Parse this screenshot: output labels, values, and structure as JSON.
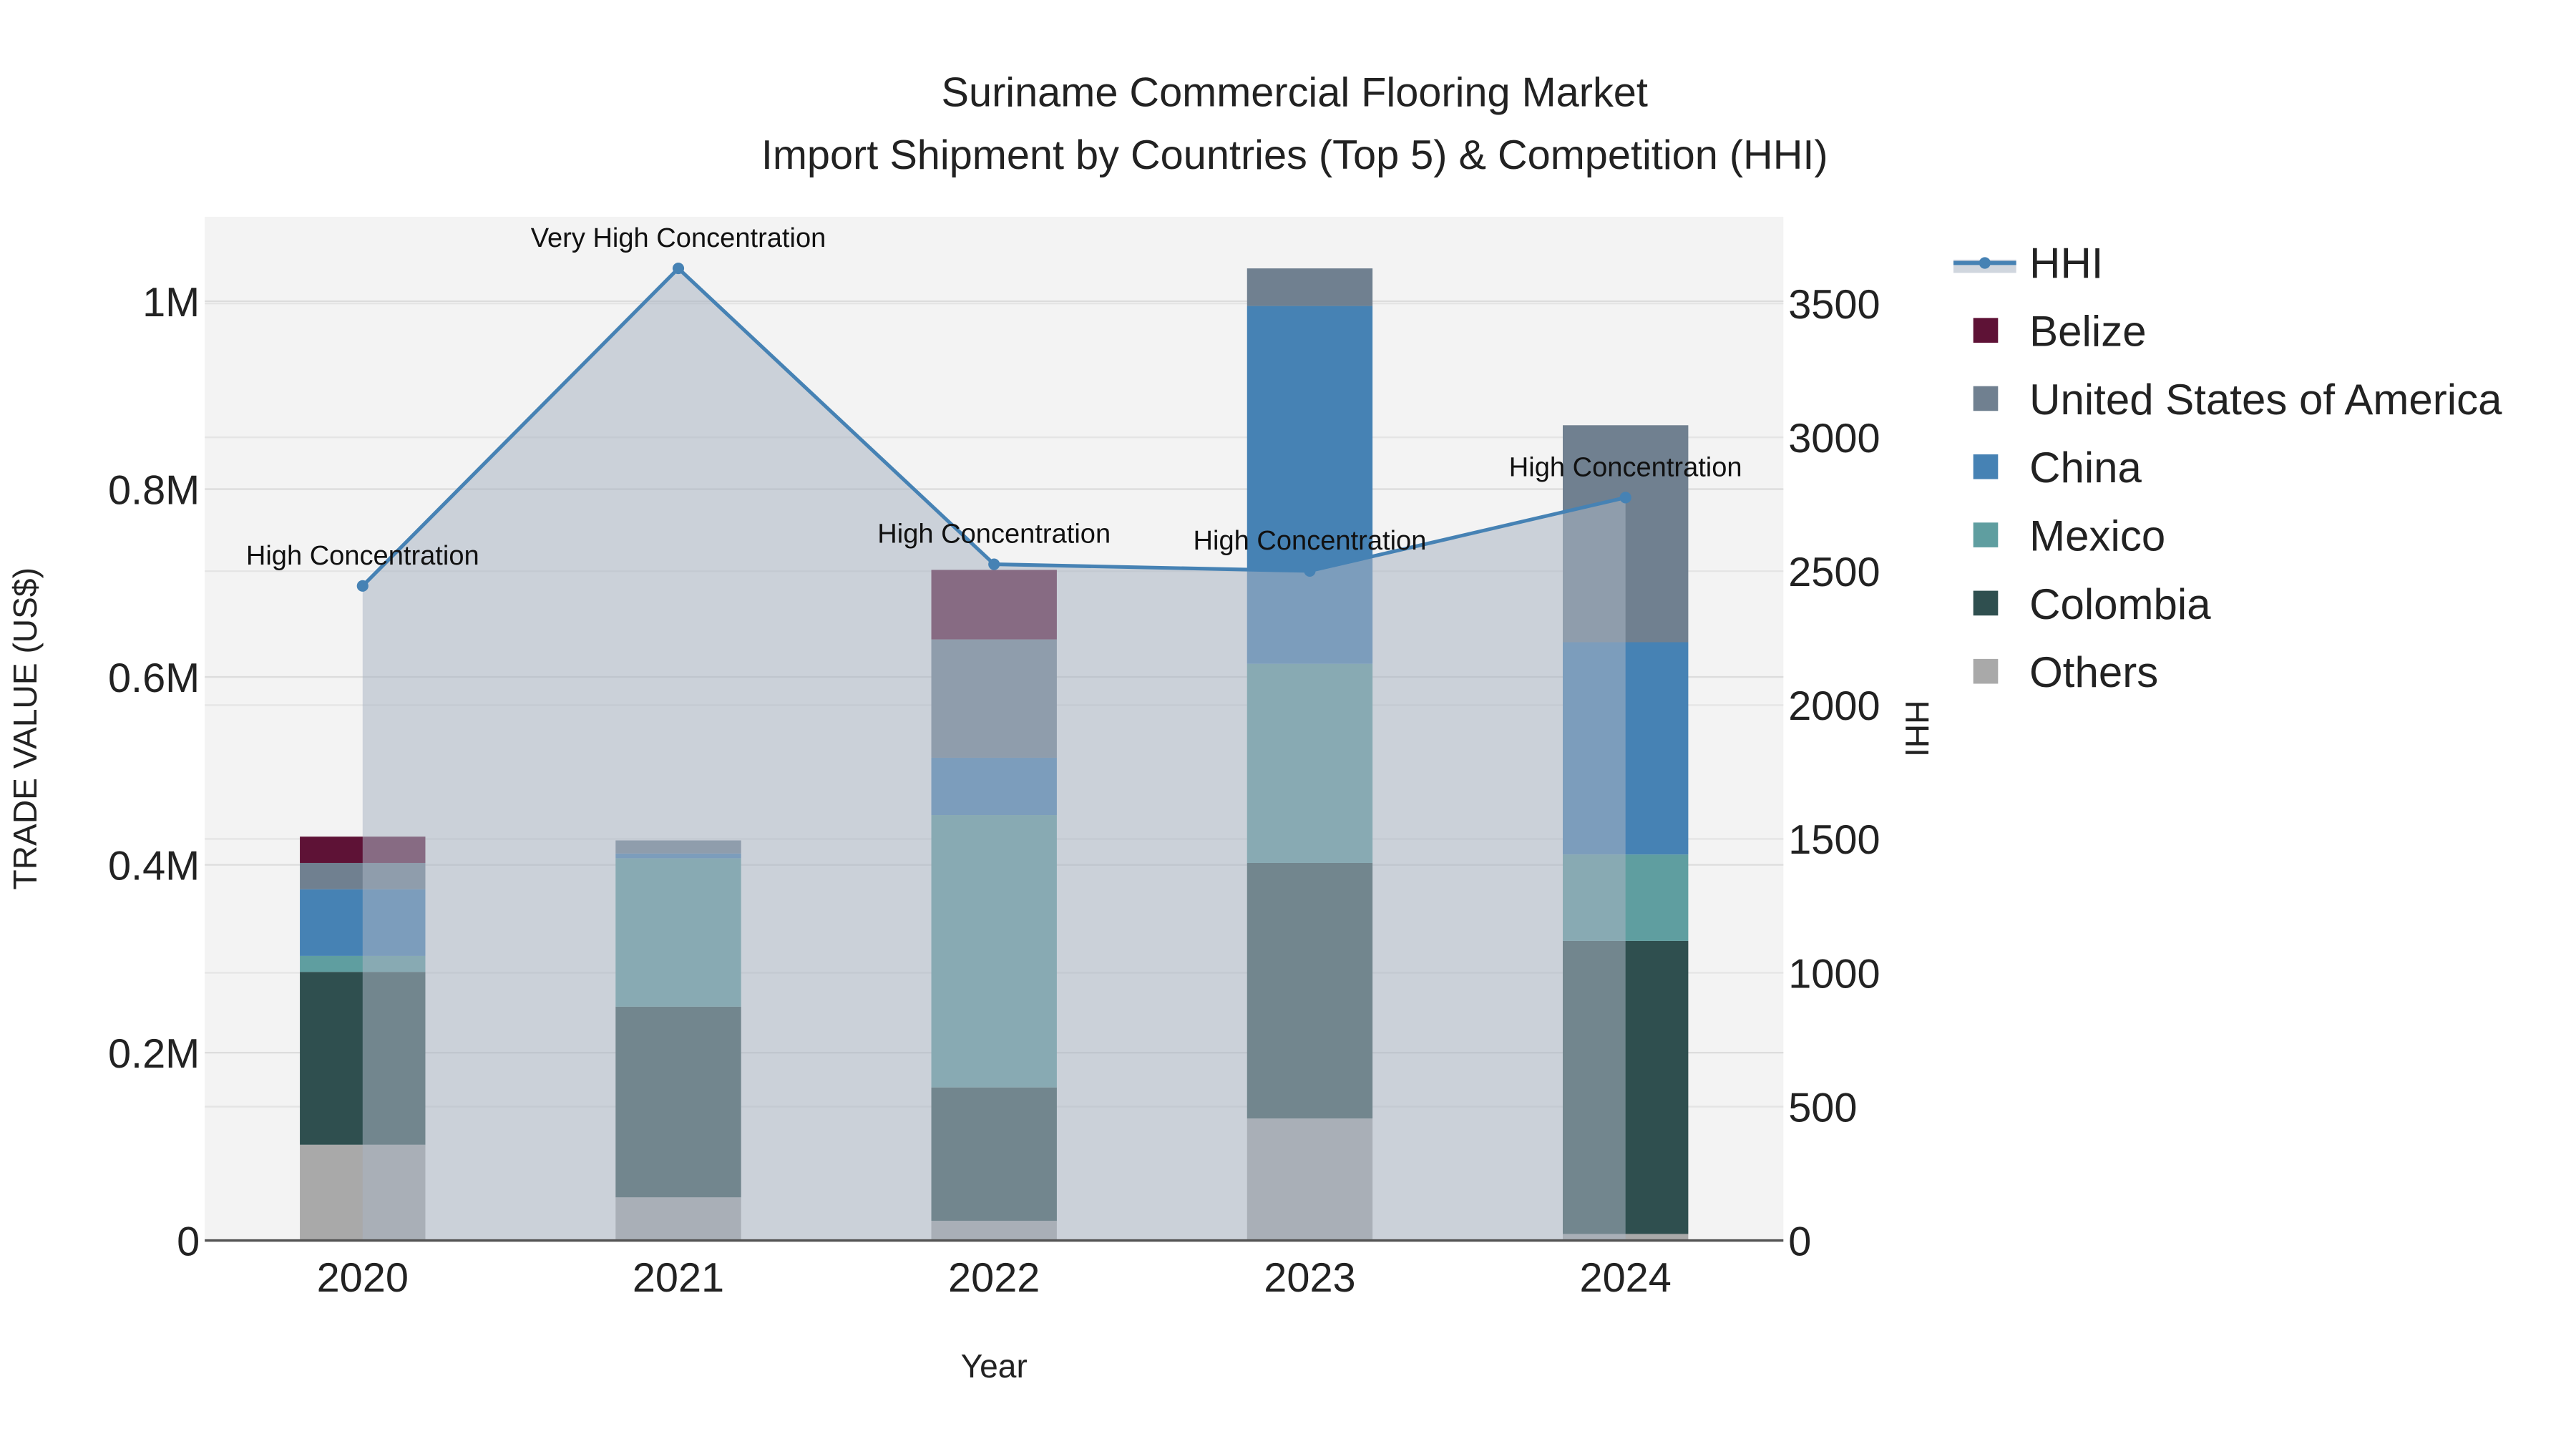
{
  "chart_data": {
    "type": "bar",
    "title": "Suriname Commercial Flooring Market",
    "subtitle": "Import Shipment by Countries (Top 5) & Competition (HHI)",
    "xlabel": "Year",
    "ylabel": "TRADE VALUE (US$)",
    "y2label": "HHI",
    "categories": [
      "2020",
      "2021",
      "2022",
      "2023",
      "2024"
    ],
    "ylim": [
      0,
      1090000
    ],
    "y2lim": [
      0,
      3824
    ],
    "yticks": [
      {
        "v": 0,
        "label": "0"
      },
      {
        "v": 200000,
        "label": "0.2M"
      },
      {
        "v": 400000,
        "label": "0.4M"
      },
      {
        "v": 600000,
        "label": "0.6M"
      },
      {
        "v": 800000,
        "label": "0.8M"
      },
      {
        "v": 1000000,
        "label": "1M"
      }
    ],
    "y2ticks": [
      {
        "v": 0,
        "label": "0"
      },
      {
        "v": 500,
        "label": "500"
      },
      {
        "v": 1000,
        "label": "1000"
      },
      {
        "v": 1500,
        "label": "1500"
      },
      {
        "v": 2000,
        "label": "2000"
      },
      {
        "v": 2500,
        "label": "2500"
      },
      {
        "v": 3000,
        "label": "3000"
      },
      {
        "v": 3500,
        "label": "3500"
      }
    ],
    "series": [
      {
        "name": "Others",
        "color": "#a9a9a9",
        "values": [
          102000,
          46000,
          21000,
          130000,
          7000
        ]
      },
      {
        "name": "Colombia",
        "color": "#2f4f4f",
        "values": [
          184000,
          203000,
          142000,
          272000,
          312000
        ]
      },
      {
        "name": "Mexico",
        "color": "#5f9ea0",
        "values": [
          17000,
          158000,
          290000,
          212000,
          92000
        ]
      },
      {
        "name": "China",
        "color": "#4682b4",
        "values": [
          71000,
          5000,
          61000,
          381000,
          226000
        ]
      },
      {
        "name": "United States of America",
        "color": "#708090",
        "values": [
          28000,
          14000,
          126000,
          40000,
          231000
        ]
      },
      {
        "name": "Belize",
        "color": "#5e1236",
        "values": [
          28000,
          0,
          74000,
          0,
          0
        ]
      }
    ],
    "hhi": {
      "name": "HHI",
      "color": "#4682b4",
      "values": [
        2445,
        3631,
        2526,
        2501,
        2775
      ],
      "annotations": [
        "High Concentration",
        "Very High Concentration",
        "High Concentration",
        "High Concentration",
        "High Concentration"
      ]
    },
    "legend_order": [
      "HHI",
      "Belize",
      "United States of America",
      "China",
      "Mexico",
      "Colombia",
      "Others"
    ],
    "legend_position": "right",
    "grid": true
  }
}
